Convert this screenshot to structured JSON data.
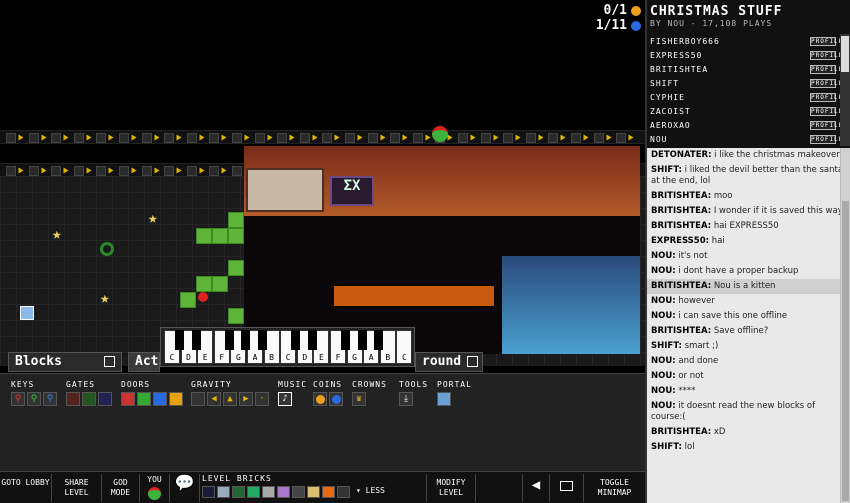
{
  "level": {
    "title": "CHRISTMAS STUFF",
    "subtitle": "BY NOU - 17,108 PLAYS"
  },
  "hud": {
    "coins_gold": "0/1",
    "coins_blue": "1/11"
  },
  "piano": {
    "keys": [
      "C",
      "D",
      "E",
      "F",
      "G",
      "A",
      "B",
      "C",
      "D",
      "E",
      "F",
      "G",
      "A",
      "B",
      "C"
    ]
  },
  "tabs": {
    "blocks": "Blocks",
    "action": "Act",
    "background": "round"
  },
  "palette": {
    "keys": "KEYS",
    "gates": "GATES",
    "doors": "DOORS",
    "gravity": "GRAVITY",
    "music": "MUSIC",
    "coins": "COINS",
    "crowns": "CROWNS",
    "tools": "TOOLS",
    "portal": "PORTAL"
  },
  "bottombar": {
    "goto_lobby": "GOTO LOBBY",
    "share_level": "SHARE LEVEL",
    "god_mode": "GOD MODE",
    "you": "YOU",
    "level_bricks": "LEVEL BRICKS",
    "less": "LESS",
    "modify_level": "MODIFY LEVEL",
    "toggle_minimap": "TOGGLE MINIMAP"
  },
  "players": [
    {
      "name": "FISHERBOY666",
      "action": "PROFILE"
    },
    {
      "name": "EXPRESS50",
      "action": "PROFILE"
    },
    {
      "name": "BRITISHTEA",
      "action": "PROFILE"
    },
    {
      "name": "SHIFT",
      "action": "PROFILE"
    },
    {
      "name": "CYPHIE",
      "action": "PROFILE"
    },
    {
      "name": "ZACOIST",
      "action": "PROFILE"
    },
    {
      "name": "AEROXAO",
      "action": "PROFILE"
    },
    {
      "name": "NOU",
      "action": "PROFILE"
    }
  ],
  "chat": [
    {
      "user": "DETONATER:",
      "text": "i like the christmas makeover",
      "hl": false
    },
    {
      "user": "SHIFT:",
      "text": "i liked the devil better than the santa at the end, lol",
      "hl": false
    },
    {
      "user": "BRITISHTEA:",
      "text": "moo",
      "hl": false
    },
    {
      "user": "BRITISHTEA:",
      "text": "I wonder if it is saved this way",
      "hl": false
    },
    {
      "user": "BRITISHTEA:",
      "text": "hai EXPRESS50",
      "hl": false
    },
    {
      "user": "EXPRESS50:",
      "text": "hai",
      "hl": false
    },
    {
      "user": "NOU:",
      "text": "it's not",
      "hl": false
    },
    {
      "user": "NOU:",
      "text": "i dont have a proper backup",
      "hl": false
    },
    {
      "user": "BRITISHTEA:",
      "text": "Nou is a kitten",
      "hl": true
    },
    {
      "user": "NOU:",
      "text": "however",
      "hl": false
    },
    {
      "user": "NOU:",
      "text": "i can save this one offline",
      "hl": false
    },
    {
      "user": "BRITISHTEA:",
      "text": "Save offline?",
      "hl": false
    },
    {
      "user": "SHIFT:",
      "text": "smart ;)",
      "hl": false
    },
    {
      "user": "NOU:",
      "text": "and done",
      "hl": false
    },
    {
      "user": "NOU:",
      "text": "or not",
      "hl": false
    },
    {
      "user": "NOU:",
      "text": "****",
      "hl": false
    },
    {
      "user": "NOU:",
      "text": "it doesnt read the new blocks of course:(",
      "hl": false
    },
    {
      "user": "BRITISHTEA:",
      "text": "xD",
      "hl": false
    },
    {
      "user": "SHIFT:",
      "text": "lol",
      "hl": false
    }
  ],
  "colors": {
    "gold_coin": "#f0a020",
    "blue_coin": "#2a6ae0",
    "green_block": "#5fb53a",
    "highlight": "#cfcfcf"
  }
}
